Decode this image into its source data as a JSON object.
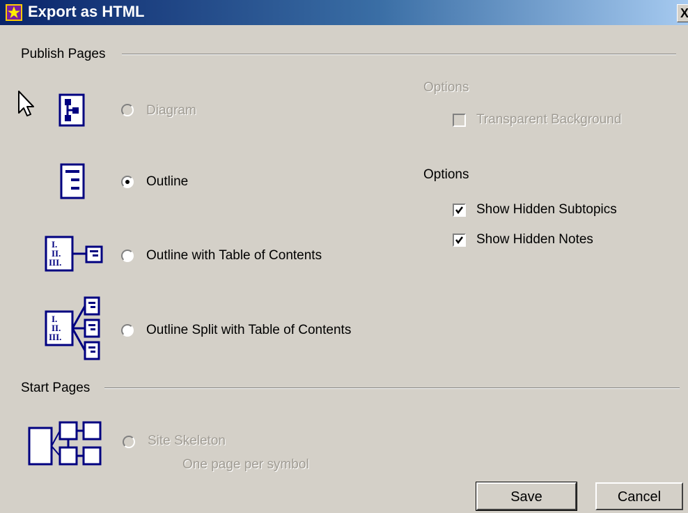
{
  "window": {
    "title": "Export as HTML",
    "close_glyph": "X"
  },
  "publish_pages": {
    "heading": "Publish Pages",
    "options": [
      {
        "label": "Diagram",
        "selected": false,
        "enabled": false,
        "icon": "diagram-page-icon"
      },
      {
        "label": "Outline",
        "selected": true,
        "enabled": true,
        "icon": "outline-page-icon"
      },
      {
        "label": "Outline with Table of Contents",
        "selected": false,
        "enabled": true,
        "icon": "outline-toc-icon"
      },
      {
        "label": "Outline Split with Table of Contents",
        "selected": false,
        "enabled": true,
        "icon": "outline-split-toc-icon"
      }
    ]
  },
  "diagram_options": {
    "heading": "Options",
    "transparent_background": {
      "label": "Transparent Background",
      "checked": false,
      "enabled": false
    }
  },
  "outline_options": {
    "heading": "Options",
    "show_hidden_subtopics": {
      "label": "Show Hidden Subtopics",
      "checked": true
    },
    "show_hidden_notes": {
      "label": "Show Hidden Notes",
      "checked": true
    }
  },
  "start_pages": {
    "heading": "Start Pages",
    "site_skeleton": {
      "label": "Site Skeleton",
      "description": "One page per symbol",
      "selected": false,
      "enabled": false,
      "icon": "site-skeleton-icon"
    }
  },
  "buttons": {
    "save": "Save",
    "cancel": "Cancel"
  },
  "colors": {
    "icon_blue": "#000080",
    "title_gradient_start": "#0a246a",
    "title_gradient_end": "#a6caf0",
    "face": "#d4d0c8"
  }
}
